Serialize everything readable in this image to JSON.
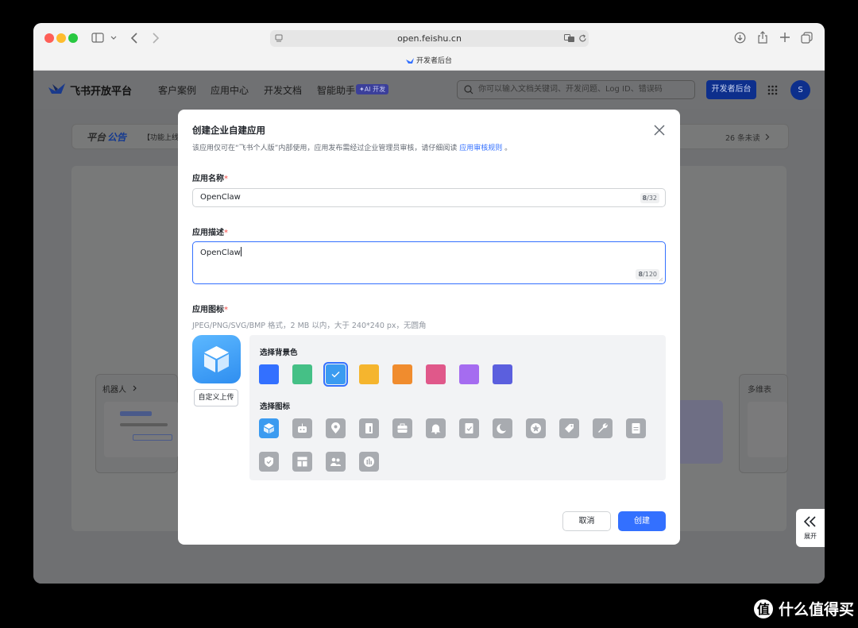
{
  "browser": {
    "url": "open.feishu.cn",
    "tab_title": "开发者后台"
  },
  "site_nav": {
    "brand": "飞书开放平台",
    "links": [
      "客户案例",
      "应用中心",
      "开发文档",
      "智能助手"
    ],
    "ai_badge": "AI 开发",
    "search_placeholder": "你可以输入文档关键词、开发问题、Log ID、错误码",
    "dev_button": "开发者后台",
    "avatar_initial": "S"
  },
  "notice_bar": {
    "label_a": "平台",
    "label_b": "公告",
    "text": "【功能上线",
    "unread": "26 条未读"
  },
  "background_cards": {
    "robot_title": "机器人",
    "right_title": "多维表"
  },
  "modal": {
    "title": "创建企业自建应用",
    "subtitle": "该应用仅可在“飞书个人版”内部使用，应用发布需经过企业管理员审核，请仔细阅读",
    "subtitle_link": "应用审核规则",
    "subtitle_end": "。",
    "name_label": "应用名称",
    "name_value": "OpenClaw",
    "name_count": "8",
    "name_max": "/32",
    "desc_label": "应用描述",
    "desc_value": "OpenClaw",
    "desc_count": "8",
    "desc_max": "/120",
    "icon_label": "应用图标",
    "icon_hint": "JPEG/PNG/SVG/BMP 格式，2 MB 以内，大于 240*240 px，无圆角",
    "upload_button": "自定义上传",
    "bg_color_label": "选择背景色",
    "icon_choice_label": "选择图标",
    "required_mark": "*",
    "cancel_button": "取消",
    "create_button": "创建",
    "bg_colors": [
      "#3370ff",
      "#45c086",
      "#3b9bf0",
      "#f5b52e",
      "#f08c2e",
      "#e0588a",
      "#a56cf0",
      "#5b5fde"
    ],
    "selected_bg_color_index": 2,
    "icons": [
      "cube-icon",
      "robot-icon",
      "location-icon",
      "document-icon",
      "toolbox-icon",
      "bell-icon",
      "checklist-icon",
      "moon-icon",
      "star-icon",
      "tag-icon",
      "wrench-icon",
      "file-icon",
      "shield-icon",
      "layout-icon",
      "people-icon",
      "chart-icon"
    ],
    "selected_icon_index": 0
  },
  "side_expand": {
    "label": "展开"
  },
  "watermark": {
    "text": "什么值得买"
  }
}
